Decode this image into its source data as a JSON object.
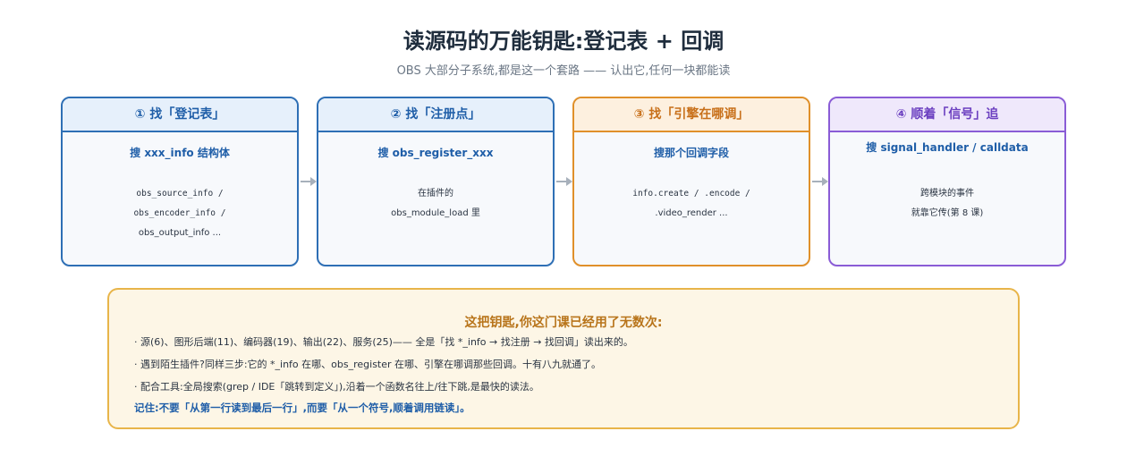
{
  "header": {
    "title": "读源码的万能钥匙:登记表 + 回调",
    "subtitle": "OBS 大部分子系统,都是这一个套路 —— 认出它,任何一块都能读"
  },
  "steps": [
    {
      "title": "① 找「登记表」",
      "key": "搜 xxx_info 结构体",
      "lines": [
        "obs_source_info /",
        "obs_encoder_info /",
        "obs_output_info ..."
      ]
    },
    {
      "title": "② 找「注册点」",
      "key": "搜 obs_register_xxx",
      "lines": [
        "在插件的",
        "obs_module_load 里"
      ]
    },
    {
      "title": "③ 找「引擎在哪调」",
      "key": "搜那个回调字段",
      "lines": [
        "info.create / .encode /",
        ".video_render ..."
      ]
    },
    {
      "title": "④ 顺着「信号」追",
      "key": "搜 signal_handler / calldata",
      "lines": [
        "跨模块的事件",
        "就靠它传(第 8 课)"
      ]
    }
  ],
  "note": {
    "title": "这把钥匙,你这门课已经用了无数次:",
    "items": [
      "· 源(6)、图形后端(11)、编码器(19)、输出(22)、服务(25)—— 全是「找 *_info → 找注册 → 找回调」读出来的。",
      "· 遇到陌生插件?同样三步:它的 *_info 在哪、obs_register 在哪、引擎在哪调那些回调。十有八九就通了。",
      "· 配合工具:全局搜索(grep / IDE「跳转到定义」),沿着一个函数名往上/往下跳,是最快的读法。"
    ],
    "key": "记住:不要「从第一行读到最后一行」,而要「从一个符号,顺着调用链读」。"
  },
  "colors": {
    "blue": "#2e6fb5",
    "orange": "#e0902a",
    "purple": "#8a5cd6",
    "note_border": "#e8b54a",
    "arrow": "#a7b0bb"
  }
}
